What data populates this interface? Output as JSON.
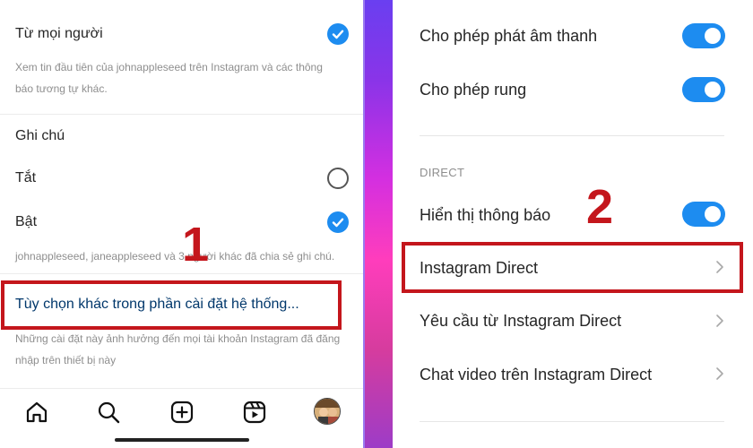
{
  "left": {
    "everyone": {
      "title": "Từ mọi người",
      "desc_line1": "Xem tin đầu tiên của johnappleseed trên Instagram và các thông",
      "desc_line2": "báo tương tự khác."
    },
    "notes": {
      "header": "Ghi chú",
      "off_label": "Tắt",
      "on_label": "Bật",
      "desc": "johnappleseed, janeappleseed và 3 người khác đã chia sẻ ghi chú."
    },
    "system_settings": {
      "link": "Tùy chọn khác trong phần cài đặt hệ thống...",
      "desc_line1": "Những cài đặt này ảnh hưởng đến mọi tài khoản Instagram đã đăng",
      "desc_line2": "nhập trên thiết bị này"
    },
    "step_number": "1",
    "nav": {
      "items": [
        "home-icon",
        "search-icon",
        "create-icon",
        "reels-icon",
        "profile-avatar"
      ]
    }
  },
  "right": {
    "sound": {
      "label": "Cho phép phát âm thanh",
      "enabled": true
    },
    "vibrate": {
      "label": "Cho phép rung",
      "enabled": true
    },
    "section_direct": "DIRECT",
    "show_notifications": {
      "label": "Hiển thị thông báo",
      "enabled": true
    },
    "step_number": "2",
    "items": [
      "Instagram Direct",
      "Yêu cầu từ Instagram Direct",
      "Chat video trên Instagram Direct"
    ]
  },
  "colors": {
    "accent_blue": "#1d8cf0",
    "highlight_red": "#c4161c",
    "link_blue": "#00376b"
  }
}
